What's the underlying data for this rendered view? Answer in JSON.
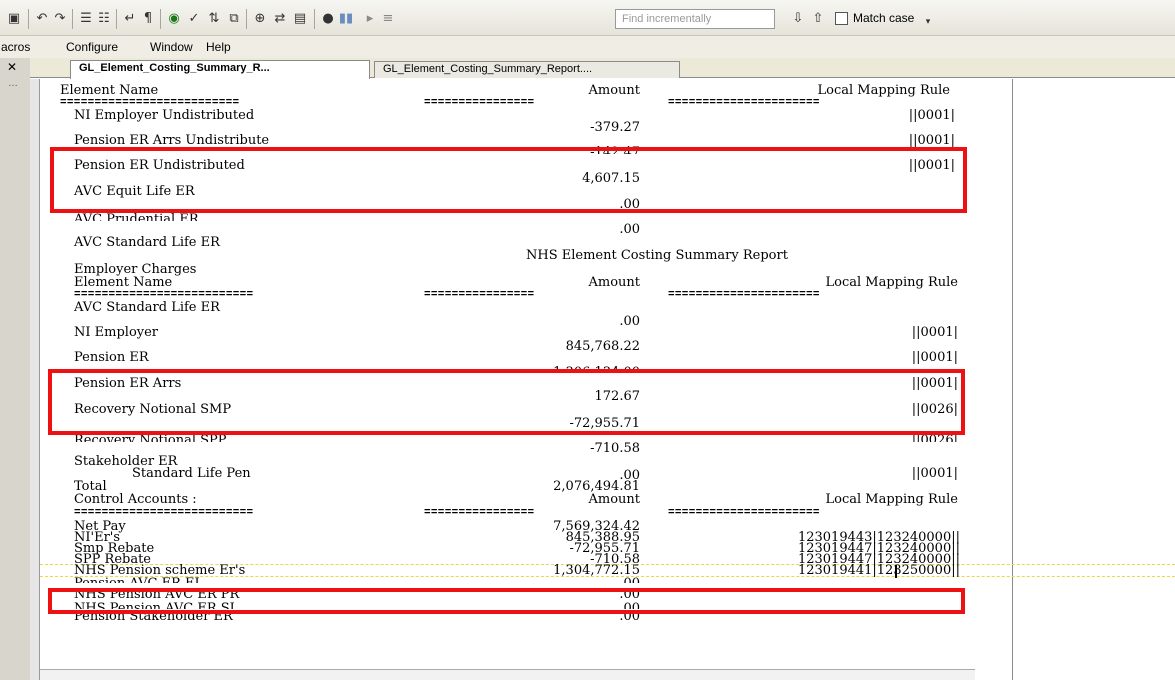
{
  "toolbar": {
    "find_placeholder": "Find incrementally",
    "match_case_label": "Match case"
  },
  "menu": {
    "macros": "acros",
    "configure": "Configure",
    "window": "Window",
    "help": "Help"
  },
  "tabs": [
    {
      "label": "GL_Element_Costing_Summary_R...",
      "active": true
    },
    {
      "label": "GL_Element_Costing_Summary_Report....",
      "active": false
    }
  ],
  "report": {
    "header": {
      "element_name": "Element Name",
      "amount": "Amount",
      "rule": "Local Mapping Rule"
    },
    "sep_name": "==========================",
    "sep_amount": "================",
    "sep_rule": "======================",
    "section1": [
      {
        "name": "NI Employer Undistributed",
        "rule": "||0001|"
      },
      {
        "amount": "-379.27"
      },
      {
        "name": "Pension ER Arrs Undistribute",
        "rule": "||0001|"
      },
      {
        "amount": "-142.47"
      },
      {
        "name": "Pension ER Undistributed",
        "rule": "||0001|"
      },
      {
        "amount": "4,607.15"
      },
      {
        "name": "AVC Equit Life ER"
      },
      {
        "amount": ".00"
      },
      {
        "name": "AVC Prudential ER"
      },
      {
        "amount": ".00"
      },
      {
        "name": "AVC Standard Life ER"
      }
    ],
    "report_title": "NHS Element Costing Summary Report",
    "employer_charges": "Employer Charges",
    "header2": {
      "element_name": "Element Name",
      "amount": "Amount",
      "rule": "Local Mapping Rule"
    },
    "section2": [
      {
        "name": "AVC Standard Life ER"
      },
      {
        "amount": ".00"
      },
      {
        "name": "NI Employer",
        "rule": "||0001|"
      },
      {
        "amount": "845,768.22"
      },
      {
        "name": "Pension ER",
        "rule": "||0001|"
      },
      {
        "amount": "1,306,134.00"
      },
      {
        "name": "Pension ER Arrs",
        "rule": "||0001|"
      },
      {
        "amount": "172.67"
      },
      {
        "name": "Recovery Notional SMP",
        "rule": "||0026|"
      },
      {
        "amount": "-72,955.71"
      },
      {
        "name": "Recovery Notional SPP",
        "rule": "||0026|"
      },
      {
        "amount": "-710.58"
      },
      {
        "name": "Stakeholder ER"
      },
      {
        "name": "Standard Life Pen",
        "amount": ".00",
        "rule": "||0001|"
      },
      {
        "name": "Total",
        "amount": "2,076,494.81"
      }
    ],
    "header3": {
      "name": "Control Accounts :",
      "amount": "Amount",
      "rule": "Local Mapping Rule"
    },
    "control_accounts": [
      {
        "name": "Net Pay",
        "amount": "7,569,324.42",
        "rule": ""
      },
      {
        "name": "NI'Er's",
        "amount": "845,388.95",
        "rule": "123019443|123240000||"
      },
      {
        "name": "Smp Rebate",
        "amount": "-72,955.71",
        "rule": "123019447|123240000||"
      },
      {
        "name": "SPP Rebate",
        "amount": "-710.58",
        "rule": "123019447|123240000||"
      },
      {
        "name": "NHS Pension scheme Er's",
        "amount": "1,304,772.15",
        "rule": "123019441|123250000||"
      },
      {
        "name": "Pension AVC ER EL",
        "amount": ".00",
        "rule": ""
      },
      {
        "name": "NHS Pension AVC ER PR",
        "amount": ".00",
        "rule": ""
      },
      {
        "name": "NHS Pension AVC ER SL",
        "amount": ".00",
        "rule": ""
      },
      {
        "name": "Pension Stakeholder ER",
        "amount": ".00",
        "rule": ""
      }
    ]
  },
  "colors": {
    "highlight": "#ee1111",
    "background": "#ffffff",
    "text": "#000000"
  }
}
